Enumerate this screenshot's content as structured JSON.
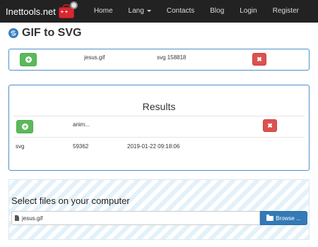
{
  "navbar": {
    "brand": "Inettools.net",
    "items": [
      {
        "label": "Home"
      },
      {
        "label": "Lang",
        "has_caret": true
      },
      {
        "label": "Contacts"
      },
      {
        "label": "Blog"
      },
      {
        "label": "Login"
      },
      {
        "label": "Register"
      }
    ]
  },
  "page": {
    "title": "GIF to SVG",
    "title_icon": "refresh-circle-icon"
  },
  "top_panel": {
    "file_name": "jesus.gif",
    "output_info": "svg 158818",
    "add_icon": "plus-circle-icon",
    "remove_icon": "close-icon"
  },
  "results": {
    "title": "Results",
    "header_label": "anim...",
    "row": {
      "format": "svg",
      "size": "59362",
      "date": "2019-01-22 09:18:06"
    }
  },
  "upload": {
    "label": "Select files on your computer",
    "file_name": "jesus.gif",
    "browse_label": "Browse ...",
    "file_icon": "file-icon",
    "browse_icon": "folder-open-icon"
  },
  "colors": {
    "navbar_bg": "#222222",
    "panel_border": "#4f8fce",
    "success": "#5cb85c",
    "danger": "#d9534f",
    "primary": "#337ab7"
  }
}
